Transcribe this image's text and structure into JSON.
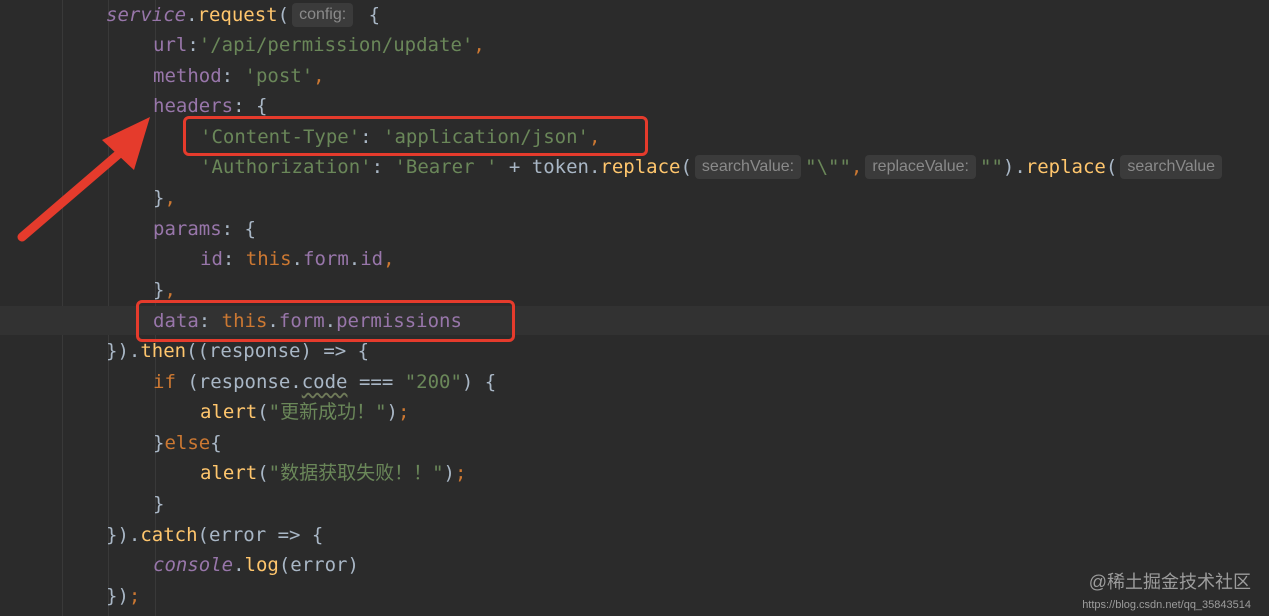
{
  "code": {
    "l1": {
      "service": "service",
      "dot": ".",
      "request": "request",
      "paren": "(",
      "hint": "config:",
      "brace": " {"
    },
    "l2": {
      "key": "url",
      "colon": ":",
      "value": "'/api/permission/update'",
      "comma": ","
    },
    "l3": {
      "key": "method",
      "colon": ": ",
      "value": "'post'",
      "comma": ","
    },
    "l4": {
      "key": "headers",
      "rest": ": {"
    },
    "l5": {
      "key": "'Content-Type'",
      "colon": ": ",
      "value": "'application/json'",
      "comma": ","
    },
    "l6": {
      "key": "'Authorization'",
      "colon": ": ",
      "str1": "'Bearer '",
      "plus": " + token.",
      "replace1": "replace",
      "open1": "(",
      "hint1": "searchValue:",
      "arg1": "\"\\\"\"",
      "comma1": ",",
      "hint2": "replaceValue:",
      "arg2": "\"\"",
      "close": ").",
      "replace2": "replace",
      "open2": "(",
      "hint3": "searchValue"
    },
    "l7": {
      "text": "}",
      "comma": ","
    },
    "l8": {
      "key": "params",
      "rest": ": {"
    },
    "l9": {
      "key": "id",
      "colon": ": ",
      "this": "this",
      "dot1": ".",
      "form": "form",
      "dot2": ".",
      "id2": "id",
      "comma": ","
    },
    "l10": {
      "text": "}",
      "comma": ","
    },
    "l11": {
      "key": "data",
      "colon": ": ",
      "this": "this",
      "dot1": ".",
      "form": "form",
      "dot2": ".",
      "permissions": "permissions"
    },
    "l12": {
      "open": "}).",
      "then": "then",
      "rest": "((response) => {"
    },
    "l13": {
      "if": "if",
      "open": " (response.",
      "code": "code",
      "op": " === ",
      "str": "\"200\"",
      "close": ") {"
    },
    "l14": {
      "fn": "alert",
      "open": "(",
      "str": "\"更新成功！\"",
      "close": ")",
      "semi": ";"
    },
    "l15": {
      "open": "}",
      "else": "else",
      "brace": "{"
    },
    "l16": {
      "fn": "alert",
      "open": "(",
      "str": "\"数据获取失败！！\"",
      "close": ")",
      "semi": ";"
    },
    "l17": {
      "text": "}"
    },
    "l18": {
      "open": "}).",
      "catch": "catch",
      "rest": "(error => {"
    },
    "l19": {
      "console": "console",
      "dot": ".",
      "log": "log",
      "rest": "(error)"
    },
    "l20": {
      "text": "})",
      "semi": ";"
    }
  },
  "watermark": {
    "site": "@稀土掘金技术社区",
    "url": "https://blog.csdn.net/qq_35843514"
  },
  "colors": {
    "background": "#2b2b2b",
    "keyword": "#cc7832",
    "function": "#ffc66d",
    "string": "#6a8759",
    "property": "#9876aa",
    "annotation": "#e53b2c"
  }
}
